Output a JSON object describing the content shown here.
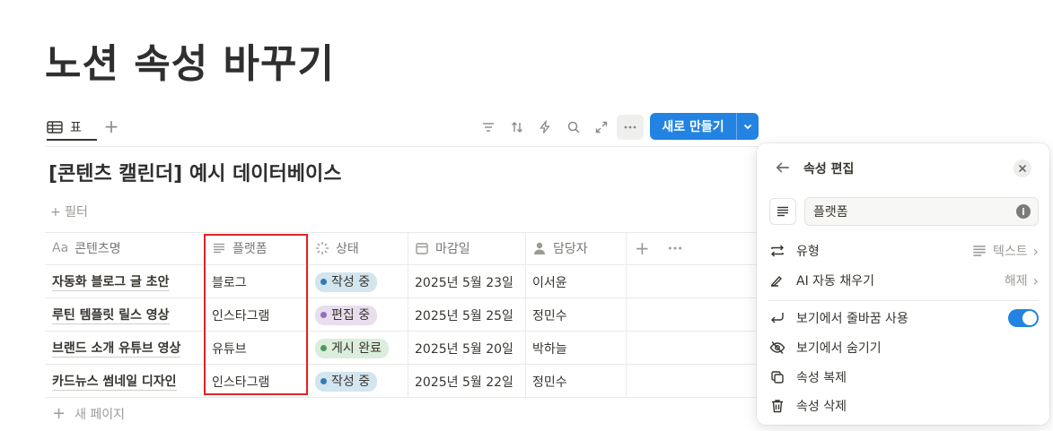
{
  "page": {
    "title": "노션 속성 바꾸기"
  },
  "view": {
    "tab_label": "표"
  },
  "toolbar": {
    "new_button_label": "새로 만들기"
  },
  "database": {
    "title": "[콘텐츠 캘린더] 예시 데이터베이스",
    "filter_label": "+ 필터",
    "columns": [
      {
        "label": "콘텐츠명",
        "icon": "text-aa-icon"
      },
      {
        "label": "플랫폼",
        "icon": "lines-icon"
      },
      {
        "label": "상태",
        "icon": "loader-icon"
      },
      {
        "label": "마감일",
        "icon": "calendar-icon"
      },
      {
        "label": "담당자",
        "icon": "person-icon"
      }
    ],
    "rows": [
      {
        "name": "자동화 블로그 글 초안",
        "platform": "블로그",
        "status": "작성 중",
        "deadline": "2025년 5월 23일",
        "owner": "이서윤"
      },
      {
        "name": "루틴 템플릿 릴스 영상",
        "platform": "인스타그램",
        "status": "편집 중",
        "deadline": "2025년 5월 25일",
        "owner": "정민수"
      },
      {
        "name": "브랜드 소개 유튜브 영상",
        "platform": "유튜브",
        "status": "게시 완료",
        "deadline": "2025년 5월 20일",
        "owner": "박하늘"
      },
      {
        "name": "카드뉴스 썸네일 디자인",
        "platform": "인스타그램",
        "status": "작성 중",
        "deadline": "2025년 5월 22일",
        "owner": "정민수"
      }
    ],
    "new_page_label": "새 페이지",
    "status_colors": {
      "작성 중": {
        "bg": "#d3e5ef",
        "dot": "#2f7db8"
      },
      "편집 중": {
        "bg": "#e8deee",
        "dot": "#9a6dbb"
      },
      "게시 완료": {
        "bg": "#dbeddb",
        "dot": "#4d9a5b"
      }
    }
  },
  "panel": {
    "title": "속성 편집",
    "name_value": "플랫폼",
    "type_label": "유형",
    "type_value": "텍스트",
    "ai_label": "AI 자동 채우기",
    "ai_value": "해제",
    "wrap_label": "보기에서 줄바꿈 사용",
    "wrap_enabled": true,
    "hide_label": "보기에서 숨기기",
    "duplicate_label": "속성 복제",
    "delete_label": "속성 삭제"
  },
  "colors": {
    "accent": "#2383e2",
    "highlight_box": "#e02424"
  }
}
